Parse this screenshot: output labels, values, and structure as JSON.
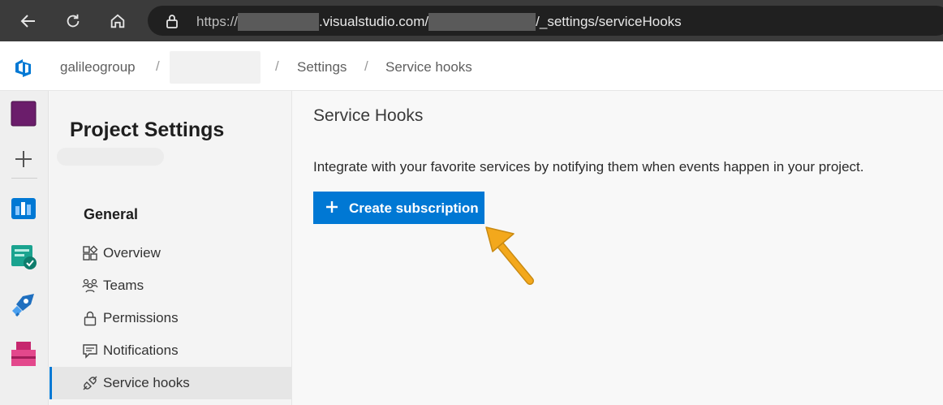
{
  "browser": {
    "url_scheme": "https://",
    "url_host": ".visualstudio.com/",
    "url_path": "/_settings/serviceHooks",
    "icons": [
      "back-arrow-icon",
      "refresh-icon",
      "home-icon",
      "lock-icon"
    ]
  },
  "header": {
    "crumbs": [
      "galileogroup",
      "Settings",
      "Service hooks"
    ],
    "separator": "/"
  },
  "rail": {
    "items": [
      {
        "name": "project-avatar",
        "color": "#6b1d6b"
      },
      {
        "name": "add-icon",
        "color": "#666666"
      },
      {
        "name": "boards-icon",
        "color": "#0078d4"
      },
      {
        "name": "test-plans-icon",
        "color": "#009c8a"
      },
      {
        "name": "pipelines-icon",
        "color": "#1f6fbf"
      },
      {
        "name": "artifacts-icon",
        "color": "#c6276e"
      }
    ]
  },
  "settings": {
    "title": "Project Settings",
    "group_title": "General",
    "items": [
      {
        "label": "Overview",
        "icon": "overview-icon"
      },
      {
        "label": "Teams",
        "icon": "teams-icon"
      },
      {
        "label": "Permissions",
        "icon": "lock-icon"
      },
      {
        "label": "Notifications",
        "icon": "notifications-icon"
      },
      {
        "label": "Service hooks",
        "icon": "service-hooks-icon",
        "active": true
      }
    ]
  },
  "main": {
    "title": "Service Hooks",
    "description": "Integrate with your favorite services by notifying them when events happen in your project.",
    "cta_label": "Create subscription"
  },
  "colors": {
    "accent": "#0078d4",
    "annotation_arrow": "#f3a81c"
  }
}
